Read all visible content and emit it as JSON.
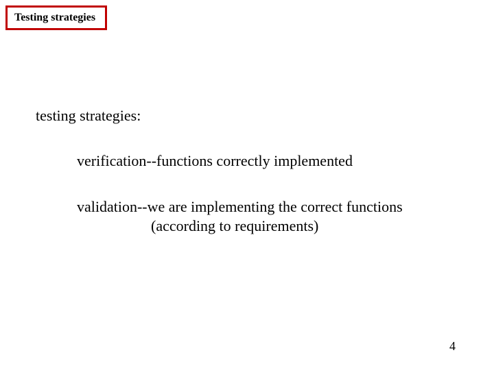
{
  "title": "Testing strategies",
  "heading": "testing strategies:",
  "item1": "verification--functions correctly implemented",
  "item2_line1": "validation--we are implementing the correct functions",
  "item2_line2": "(according to requirements)",
  "page_number": "4"
}
